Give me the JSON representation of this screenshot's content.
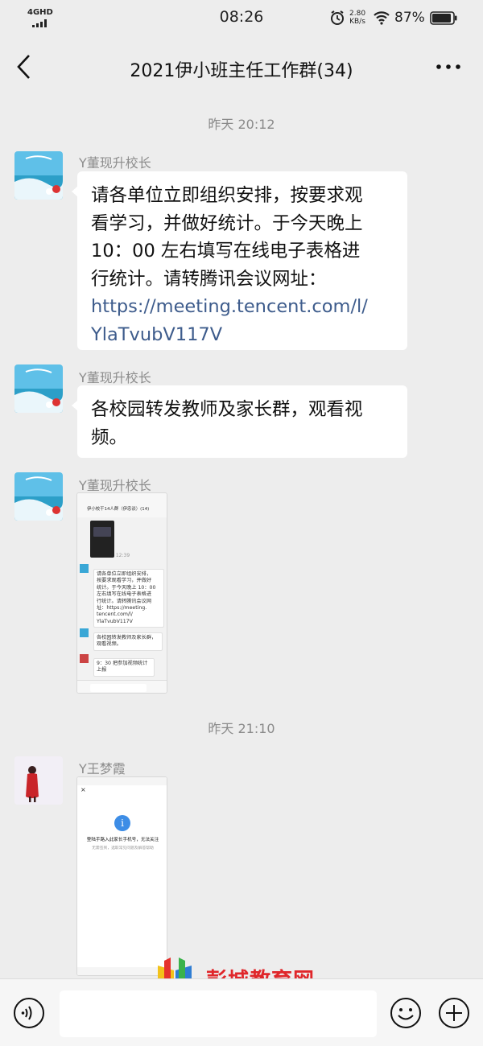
{
  "status_bar": {
    "network": "4GHD",
    "time": "08:26",
    "speed_top": "2.80",
    "speed_bottom": "KB/s",
    "battery": "87%"
  },
  "header": {
    "title": "2021伊小班主任工作群(34)"
  },
  "timestamps": [
    "昨天 20:12",
    "昨天 21:10"
  ],
  "messages": [
    {
      "sender": "Y董现升校长",
      "lines": [
        "请各单位立即组织安排，按要求观",
        "看学习，并做好统计。于今天晚上",
        "10：00 左右填写在线电子表格进",
        "行统计。请转腾讯会议网址："
      ],
      "link_lines": [
        "https://meeting.tencent.com/l/",
        "YlaTvubV117V"
      ]
    },
    {
      "sender": "Y董现升校长",
      "lines": [
        "各校园转发教师及家长群，观看视",
        "频。"
      ]
    },
    {
      "sender": "Y董现升校长"
    },
    {
      "sender": "Y王梦霞"
    }
  ],
  "shot1": {
    "title": "伊小校干14人群（伊忠谈）(14)",
    "time": "12:39",
    "bubble1": [
      "请各单位立即组织安排，",
      "按要求观看学习，并做好",
      "统计。于今天晚上 10：00",
      "左右填写在线电子表格进",
      "行统计。请转腾讯会议网",
      "址：https://meeting.",
      "tencent.com/l/",
      "YlaTvubV117V"
    ],
    "bubble2": [
      "各校园转发教师及家长群，",
      "观看视频。"
    ],
    "bubble3": [
      "9：30 把参加视频统计",
      "上报"
    ]
  },
  "shot2": {
    "notice": "登陆手路入此家长手机号，无法关注",
    "sub": "无需签到，选取常见问题及解答帮助"
  },
  "watermark": {
    "text": "彭城教育网"
  },
  "colors": {
    "background": "#ededed",
    "link": "#3e5c8c",
    "watermark": "#e0262a",
    "info": "#3d8de6"
  }
}
